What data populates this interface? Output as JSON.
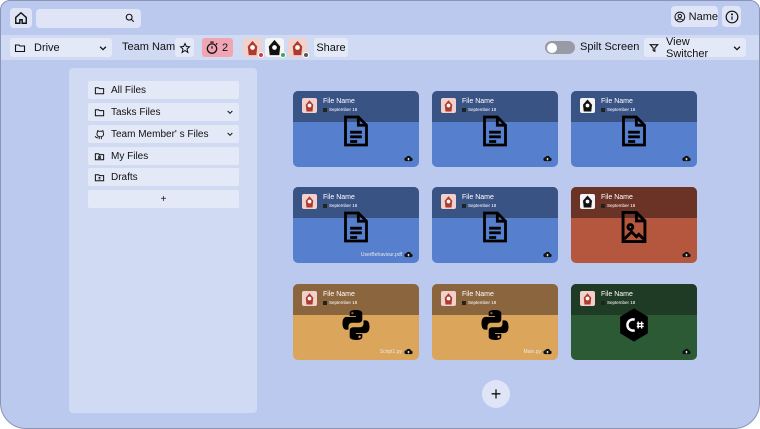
{
  "topbar": {
    "search_value": "",
    "user_label": "Name"
  },
  "toolbar": {
    "drive_label": "Drive",
    "team_label": "Team Name",
    "timer_count": "2",
    "share_label": "Share",
    "split_label": "Spilt Screen",
    "view_switcher_label": "View Switcher",
    "split_enabled": false
  },
  "sidebar": {
    "items": [
      {
        "label": "All Files",
        "icon": "folder-icon"
      },
      {
        "label": "Tasks Files",
        "icon": "folder-icon"
      },
      {
        "label": "Team Member' s Files",
        "icon": "github-icon"
      },
      {
        "label": "My Files",
        "icon": "user-folder-icon"
      },
      {
        "label": "Drafts",
        "icon": "draft-folder-icon"
      }
    ],
    "add_label": "+"
  },
  "files": [
    {
      "name": "File Name",
      "date": "September 18",
      "type": "document",
      "color": "blue",
      "tag": ""
    },
    {
      "name": "File Name",
      "date": "September 18",
      "type": "document",
      "color": "blue",
      "tag": ""
    },
    {
      "name": "File Name",
      "date": "September 18",
      "type": "document",
      "color": "blue",
      "tag": ""
    },
    {
      "name": "File Name",
      "date": "September 18",
      "type": "document",
      "color": "blue",
      "tag": "UserBehaviour.pdf"
    },
    {
      "name": "File Name",
      "date": "September 18",
      "type": "document",
      "color": "blue",
      "tag": ""
    },
    {
      "name": "File Name",
      "date": "September 18",
      "type": "image",
      "color": "red",
      "tag": ""
    },
    {
      "name": "File Name",
      "date": "September 18",
      "type": "python",
      "color": "amber",
      "tag": "Script1.py"
    },
    {
      "name": "File Name",
      "date": "September 18",
      "type": "python",
      "color": "amber",
      "tag": "Main.py"
    },
    {
      "name": "File Name",
      "date": "September 18",
      "type": "csharp",
      "color": "green",
      "tag": ""
    }
  ],
  "fab_label": "+"
}
